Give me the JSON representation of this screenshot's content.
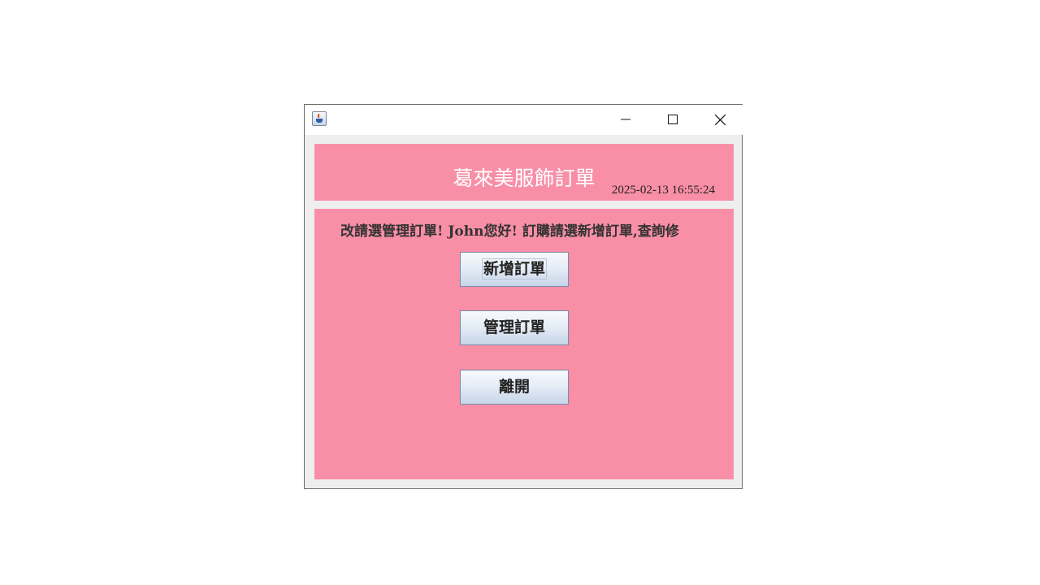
{
  "window": {
    "controls": {
      "minimize_icon": "minimize-icon",
      "maximize_icon": "maximize-icon",
      "close_icon": "close-icon"
    },
    "app_icon": "java-cup-icon"
  },
  "header": {
    "title": "葛來美服飾訂單",
    "datetime": "2025-02-13 16:55:24"
  },
  "main": {
    "welcome_text": "改請選管理訂單! John您好! 訂購請選新增訂單,查詢修",
    "buttons": {
      "new_order": "新增訂單",
      "manage_orders": "管理訂單",
      "exit": "離開"
    }
  },
  "colors": {
    "panel_background": "#f88fa6",
    "window_background": "#eeeeee",
    "title_text": "#ffffff"
  }
}
